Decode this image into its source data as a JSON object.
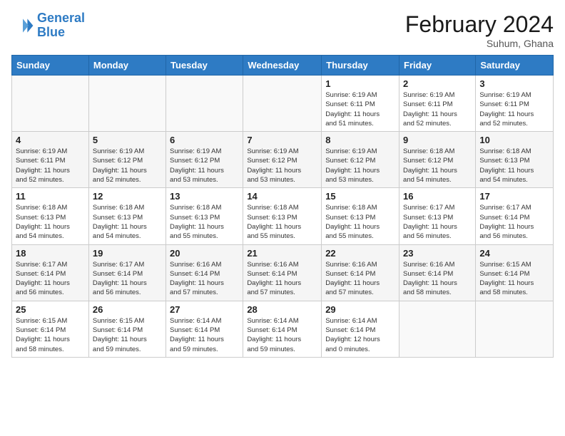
{
  "header": {
    "logo_line1": "General",
    "logo_line2": "Blue",
    "month_title": "February 2024",
    "subtitle": "Suhum, Ghana"
  },
  "weekdays": [
    "Sunday",
    "Monday",
    "Tuesday",
    "Wednesday",
    "Thursday",
    "Friday",
    "Saturday"
  ],
  "weeks": [
    [
      {
        "day": "",
        "info": ""
      },
      {
        "day": "",
        "info": ""
      },
      {
        "day": "",
        "info": ""
      },
      {
        "day": "",
        "info": ""
      },
      {
        "day": "1",
        "info": "Sunrise: 6:19 AM\nSunset: 6:11 PM\nDaylight: 11 hours\nand 51 minutes."
      },
      {
        "day": "2",
        "info": "Sunrise: 6:19 AM\nSunset: 6:11 PM\nDaylight: 11 hours\nand 52 minutes."
      },
      {
        "day": "3",
        "info": "Sunrise: 6:19 AM\nSunset: 6:11 PM\nDaylight: 11 hours\nand 52 minutes."
      }
    ],
    [
      {
        "day": "4",
        "info": "Sunrise: 6:19 AM\nSunset: 6:11 PM\nDaylight: 11 hours\nand 52 minutes."
      },
      {
        "day": "5",
        "info": "Sunrise: 6:19 AM\nSunset: 6:12 PM\nDaylight: 11 hours\nand 52 minutes."
      },
      {
        "day": "6",
        "info": "Sunrise: 6:19 AM\nSunset: 6:12 PM\nDaylight: 11 hours\nand 53 minutes."
      },
      {
        "day": "7",
        "info": "Sunrise: 6:19 AM\nSunset: 6:12 PM\nDaylight: 11 hours\nand 53 minutes."
      },
      {
        "day": "8",
        "info": "Sunrise: 6:19 AM\nSunset: 6:12 PM\nDaylight: 11 hours\nand 53 minutes."
      },
      {
        "day": "9",
        "info": "Sunrise: 6:18 AM\nSunset: 6:12 PM\nDaylight: 11 hours\nand 54 minutes."
      },
      {
        "day": "10",
        "info": "Sunrise: 6:18 AM\nSunset: 6:13 PM\nDaylight: 11 hours\nand 54 minutes."
      }
    ],
    [
      {
        "day": "11",
        "info": "Sunrise: 6:18 AM\nSunset: 6:13 PM\nDaylight: 11 hours\nand 54 minutes."
      },
      {
        "day": "12",
        "info": "Sunrise: 6:18 AM\nSunset: 6:13 PM\nDaylight: 11 hours\nand 54 minutes."
      },
      {
        "day": "13",
        "info": "Sunrise: 6:18 AM\nSunset: 6:13 PM\nDaylight: 11 hours\nand 55 minutes."
      },
      {
        "day": "14",
        "info": "Sunrise: 6:18 AM\nSunset: 6:13 PM\nDaylight: 11 hours\nand 55 minutes."
      },
      {
        "day": "15",
        "info": "Sunrise: 6:18 AM\nSunset: 6:13 PM\nDaylight: 11 hours\nand 55 minutes."
      },
      {
        "day": "16",
        "info": "Sunrise: 6:17 AM\nSunset: 6:13 PM\nDaylight: 11 hours\nand 56 minutes."
      },
      {
        "day": "17",
        "info": "Sunrise: 6:17 AM\nSunset: 6:14 PM\nDaylight: 11 hours\nand 56 minutes."
      }
    ],
    [
      {
        "day": "18",
        "info": "Sunrise: 6:17 AM\nSunset: 6:14 PM\nDaylight: 11 hours\nand 56 minutes."
      },
      {
        "day": "19",
        "info": "Sunrise: 6:17 AM\nSunset: 6:14 PM\nDaylight: 11 hours\nand 56 minutes."
      },
      {
        "day": "20",
        "info": "Sunrise: 6:16 AM\nSunset: 6:14 PM\nDaylight: 11 hours\nand 57 minutes."
      },
      {
        "day": "21",
        "info": "Sunrise: 6:16 AM\nSunset: 6:14 PM\nDaylight: 11 hours\nand 57 minutes."
      },
      {
        "day": "22",
        "info": "Sunrise: 6:16 AM\nSunset: 6:14 PM\nDaylight: 11 hours\nand 57 minutes."
      },
      {
        "day": "23",
        "info": "Sunrise: 6:16 AM\nSunset: 6:14 PM\nDaylight: 11 hours\nand 58 minutes."
      },
      {
        "day": "24",
        "info": "Sunrise: 6:15 AM\nSunset: 6:14 PM\nDaylight: 11 hours\nand 58 minutes."
      }
    ],
    [
      {
        "day": "25",
        "info": "Sunrise: 6:15 AM\nSunset: 6:14 PM\nDaylight: 11 hours\nand 58 minutes."
      },
      {
        "day": "26",
        "info": "Sunrise: 6:15 AM\nSunset: 6:14 PM\nDaylight: 11 hours\nand 59 minutes."
      },
      {
        "day": "27",
        "info": "Sunrise: 6:14 AM\nSunset: 6:14 PM\nDaylight: 11 hours\nand 59 minutes."
      },
      {
        "day": "28",
        "info": "Sunrise: 6:14 AM\nSunset: 6:14 PM\nDaylight: 11 hours\nand 59 minutes."
      },
      {
        "day": "29",
        "info": "Sunrise: 6:14 AM\nSunset: 6:14 PM\nDaylight: 12 hours\nand 0 minutes."
      },
      {
        "day": "",
        "info": ""
      },
      {
        "day": "",
        "info": ""
      }
    ]
  ]
}
